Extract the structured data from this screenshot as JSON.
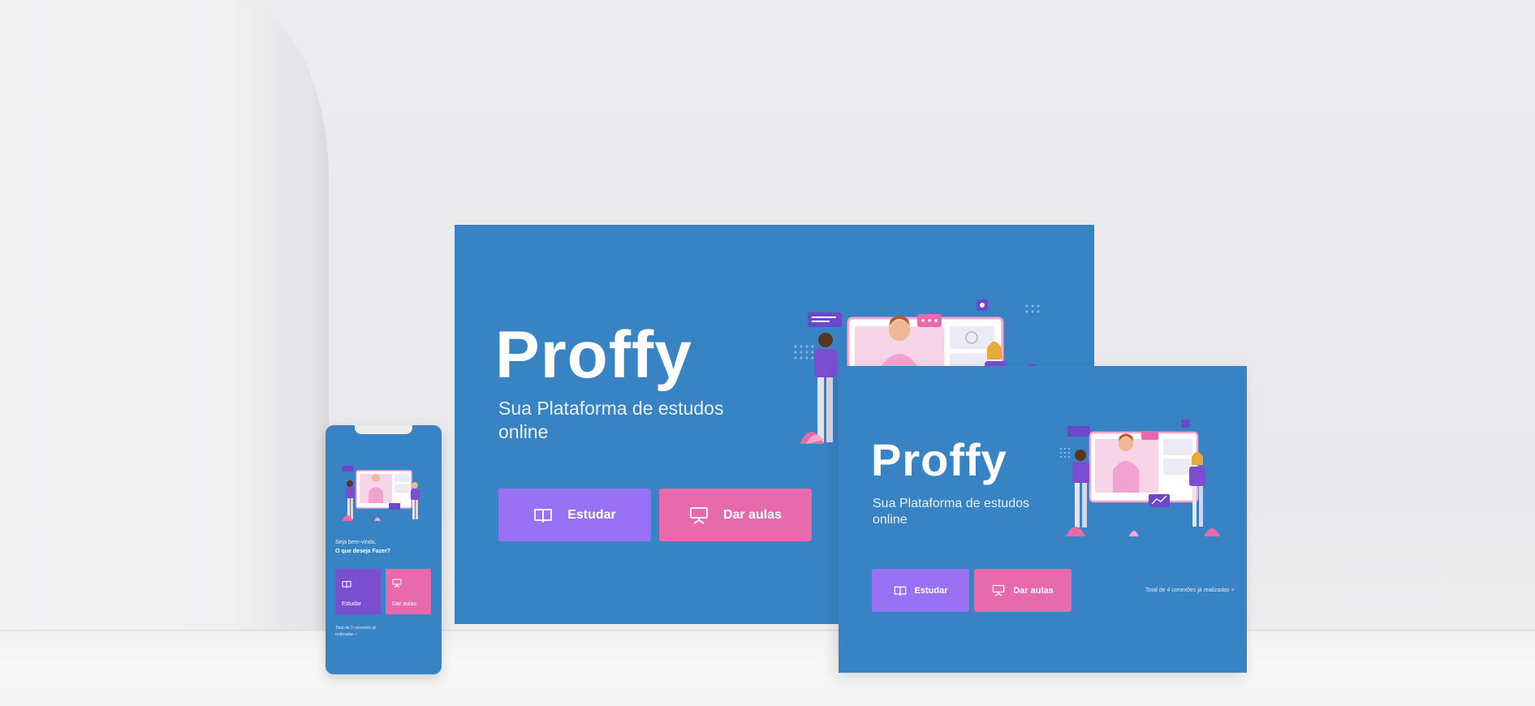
{
  "brand": {
    "name": "Proffy",
    "tagline": "Sua Plataforma de estudos online"
  },
  "actions": {
    "study_label": "Estudar",
    "teach_label": "Dar aulas"
  },
  "footer": {
    "connections_text_medium": "Total de 4 conexões já realizadas",
    "connections_text_phone": "Total de 3 conexões já realizadas"
  },
  "phone": {
    "welcome": "Seja bem-vindo,",
    "question": "O que deseja Fazer?"
  },
  "icons": {
    "study": "open-book-icon",
    "teach": "presentation-board-icon",
    "heart": "heart-icon"
  },
  "colors": {
    "background": "#3883c3",
    "study_button": "#9871f5",
    "teach_button": "#e76aac",
    "accent_purple": "#7a4ed1",
    "accent_pink": "#f4a6cf"
  }
}
